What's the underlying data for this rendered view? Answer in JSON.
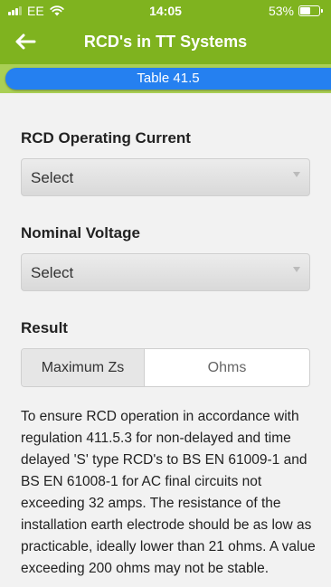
{
  "status_bar": {
    "carrier": "EE",
    "time": "14:05",
    "battery": "53%",
    "battery_level": 0.53,
    "icons": [
      "signal-icon",
      "wifi-icon",
      "battery-icon"
    ]
  },
  "nav": {
    "title": "RCD's in TT Systems",
    "back_icon": "arrow-left-icon"
  },
  "tab": {
    "label": "Table 41.5"
  },
  "fields": [
    {
      "label": "RCD Operating Current",
      "value": "Select"
    },
    {
      "label": "Nominal Voltage",
      "value": "Select"
    }
  ],
  "result": {
    "heading": "Result",
    "label": "Maximum Zs",
    "value": "Ohms"
  },
  "description": "To ensure RCD operation in accordance with regulation 411.5.3 for non-delayed and time delayed 'S' type RCD's to BS EN 61009-1 and BS EN 61008-1 for AC final circuits not exceeding 32 amps. The resistance of the installation earth electrode should be as low as practicable, ideally lower than 21 ohms. A value exceeding 200 ohms may not be stable.",
  "colors": {
    "header_green": "#7fb31f",
    "tab_strip_green": "#aacf55",
    "tab_blue": "#2580f0"
  }
}
